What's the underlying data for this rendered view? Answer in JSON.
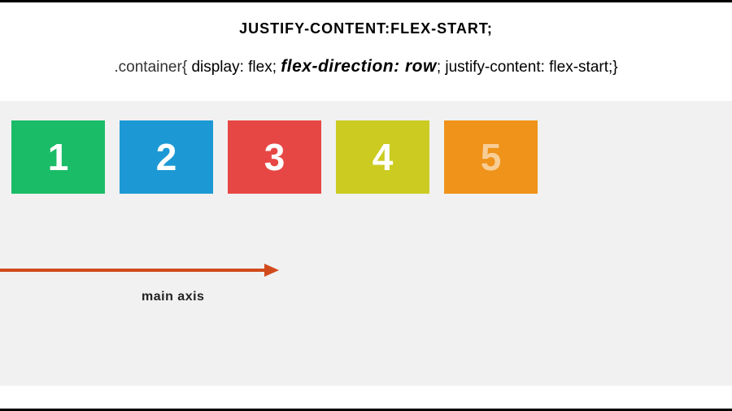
{
  "title": "JUSTIFY-CONTENT:FLEX-START;",
  "code": {
    "selector": ".container{",
    "prop1": "display: flex;",
    "prop2": "flex-direction: row",
    "semicolon": ";",
    "prop3": "justify-content: flex-start;}",
    "separator": "  "
  },
  "boxes": [
    {
      "label": "1",
      "color": "#1abc68",
      "light": false
    },
    {
      "label": "2",
      "color": "#1c99d4",
      "light": false
    },
    {
      "label": "3",
      "color": "#e74744",
      "light": false
    },
    {
      "label": "4",
      "color": "#cbcb22",
      "light": false
    },
    {
      "label": "5",
      "color": "#f0931a",
      "light": true
    }
  ],
  "axis_label": "main axis",
  "arrow_color": "#d14a1c"
}
